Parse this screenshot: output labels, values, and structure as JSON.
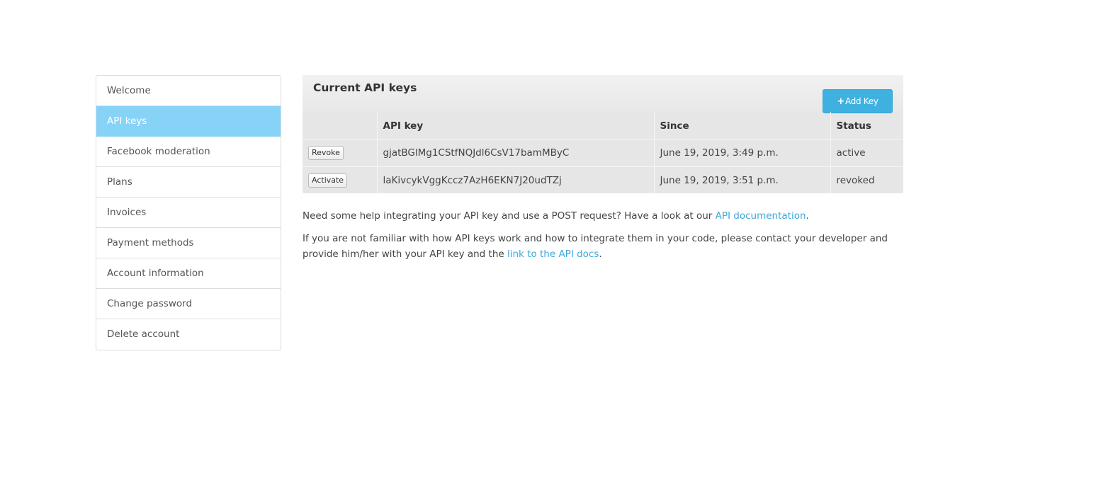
{
  "sidebar": {
    "items": [
      {
        "label": "Welcome"
      },
      {
        "label": "API keys",
        "active": true
      },
      {
        "label": "Facebook moderation"
      },
      {
        "label": "Plans"
      },
      {
        "label": "Invoices"
      },
      {
        "label": "Payment methods"
      },
      {
        "label": "Account information"
      },
      {
        "label": "Change password"
      },
      {
        "label": "Delete account"
      }
    ],
    "active_color": "#87d3f7"
  },
  "panel": {
    "title": "Current API keys",
    "add_button": {
      "icon": "plus-icon",
      "label": "Add Key"
    },
    "columns": [
      "API key",
      "Since",
      "Status"
    ],
    "rows": [
      {
        "action": "Revoke",
        "key": "gjatBGlMg1CStfNQJdl6CsV17bamMByC",
        "since": "June 19, 2019, 3:49 p.m.",
        "status": "active"
      },
      {
        "action": "Activate",
        "key": "laKivcykVggKccz7AzH6EKN7J20udTZj",
        "since": "June 19, 2019, 3:51 p.m.",
        "status": "revoked"
      }
    ]
  },
  "help": {
    "p1_text": "Need some help integrating your API key and use a POST request? Have a look at our ",
    "p1_link": "API documentation",
    "p1_end": ".",
    "p2_text": "If you are not familiar with how API keys work and how to integrate them in your code, please contact your developer and provide him/her with your API key and the ",
    "p2_link": "link to the API docs",
    "p2_end": "."
  },
  "colors": {
    "accent": "#3fb1e0",
    "link": "#3fa8d8"
  }
}
